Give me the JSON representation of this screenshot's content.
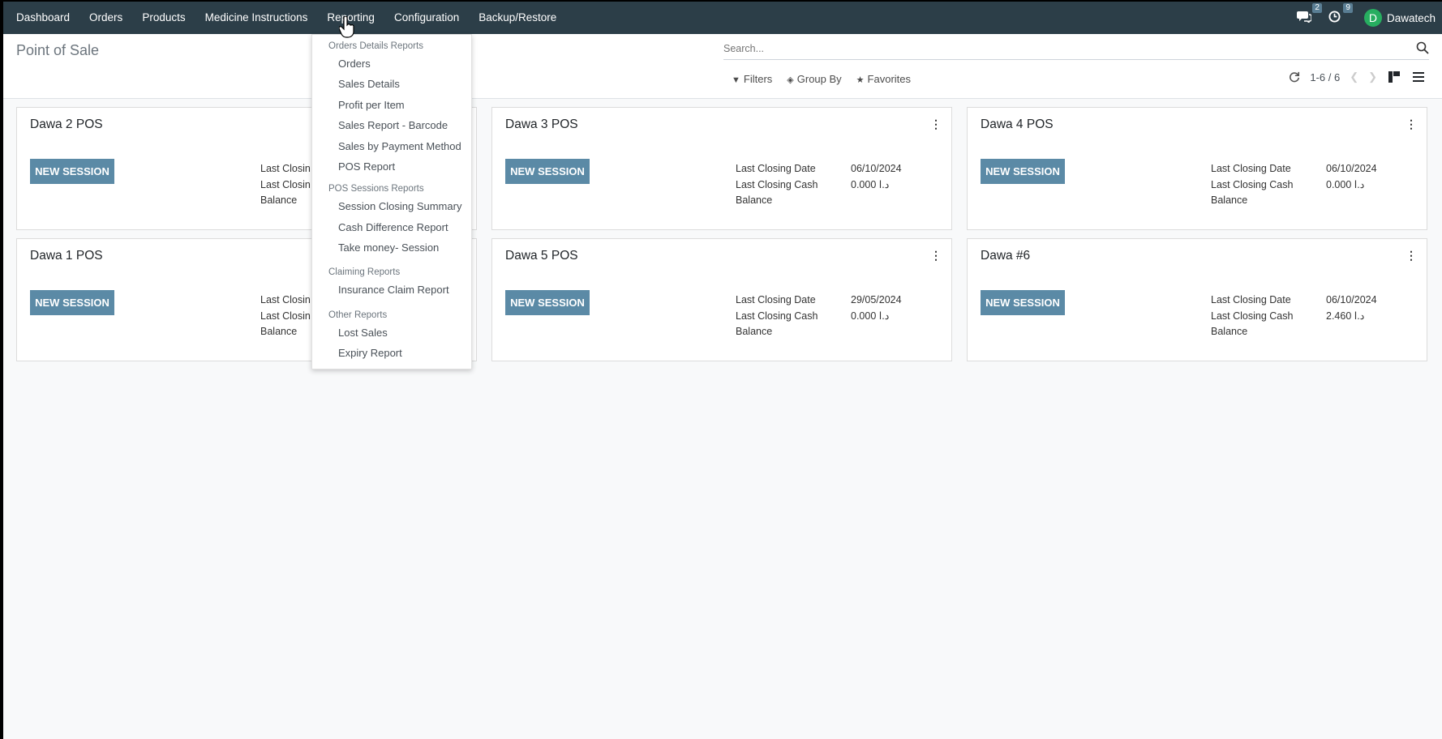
{
  "navbar": {
    "items": [
      "Dashboard",
      "Orders",
      "Products",
      "Medicine Instructions",
      "Reporting",
      "Configuration",
      "Backup/Restore"
    ],
    "messages_badge": "2",
    "activities_badge": "9",
    "user_initial": "D",
    "user_name": "Dawatech",
    "avatar_color": "#27ae60"
  },
  "control": {
    "breadcrumb": "Point of Sale",
    "search_placeholder": "Search...",
    "filters_label": "Filters",
    "group_by_label": "Group By",
    "favorites_label": "Favorites",
    "pager_value": "1-6 / 6"
  },
  "reporting_menu": {
    "sections": [
      {
        "header": "Orders Details Reports",
        "items": [
          "Orders",
          "Sales Details",
          "Profit per Item",
          "Sales Report - Barcode",
          "Sales by Payment Method",
          "POS Report"
        ]
      },
      {
        "header": "POS Sessions Reports",
        "items": [
          "Session Closing Summary",
          "Cash Difference Report",
          "Take money- Session"
        ]
      },
      {
        "header": "Claiming Reports",
        "items": [
          "Insurance Claim Report"
        ]
      },
      {
        "header": "Other Reports",
        "items": [
          "Lost Sales",
          "Expiry Report"
        ]
      }
    ]
  },
  "kanban": {
    "new_session_label": "NEW SESSION",
    "last_closing_date_label": "Last Closing Date",
    "last_closing_cash_label": "Last Closing Cash",
    "balance_label": "Balance",
    "partial_date_label": "Last Closin",
    "partial_cash_label": "Last Closin",
    "cards": [
      {
        "title": "Dawa 2 POS",
        "date": "",
        "cash": ""
      },
      {
        "title": "Dawa 3 POS",
        "date": "06/10/2024",
        "cash": "0.000  د.ا"
      },
      {
        "title": "Dawa 4 POS",
        "date": "06/10/2024",
        "cash": "0.000  د.ا"
      },
      {
        "title": "Dawa 1 POS",
        "date": "",
        "cash": ""
      },
      {
        "title": "Dawa 5 POS",
        "date": "29/05/2024",
        "cash": "0.000  د.ا"
      },
      {
        "title": "Dawa #6",
        "date": "06/10/2024",
        "cash": "2.460  د.ا"
      }
    ]
  },
  "colors": {
    "navbar_bg": "#2c3e48",
    "button_bg": "#5b8aa6"
  }
}
